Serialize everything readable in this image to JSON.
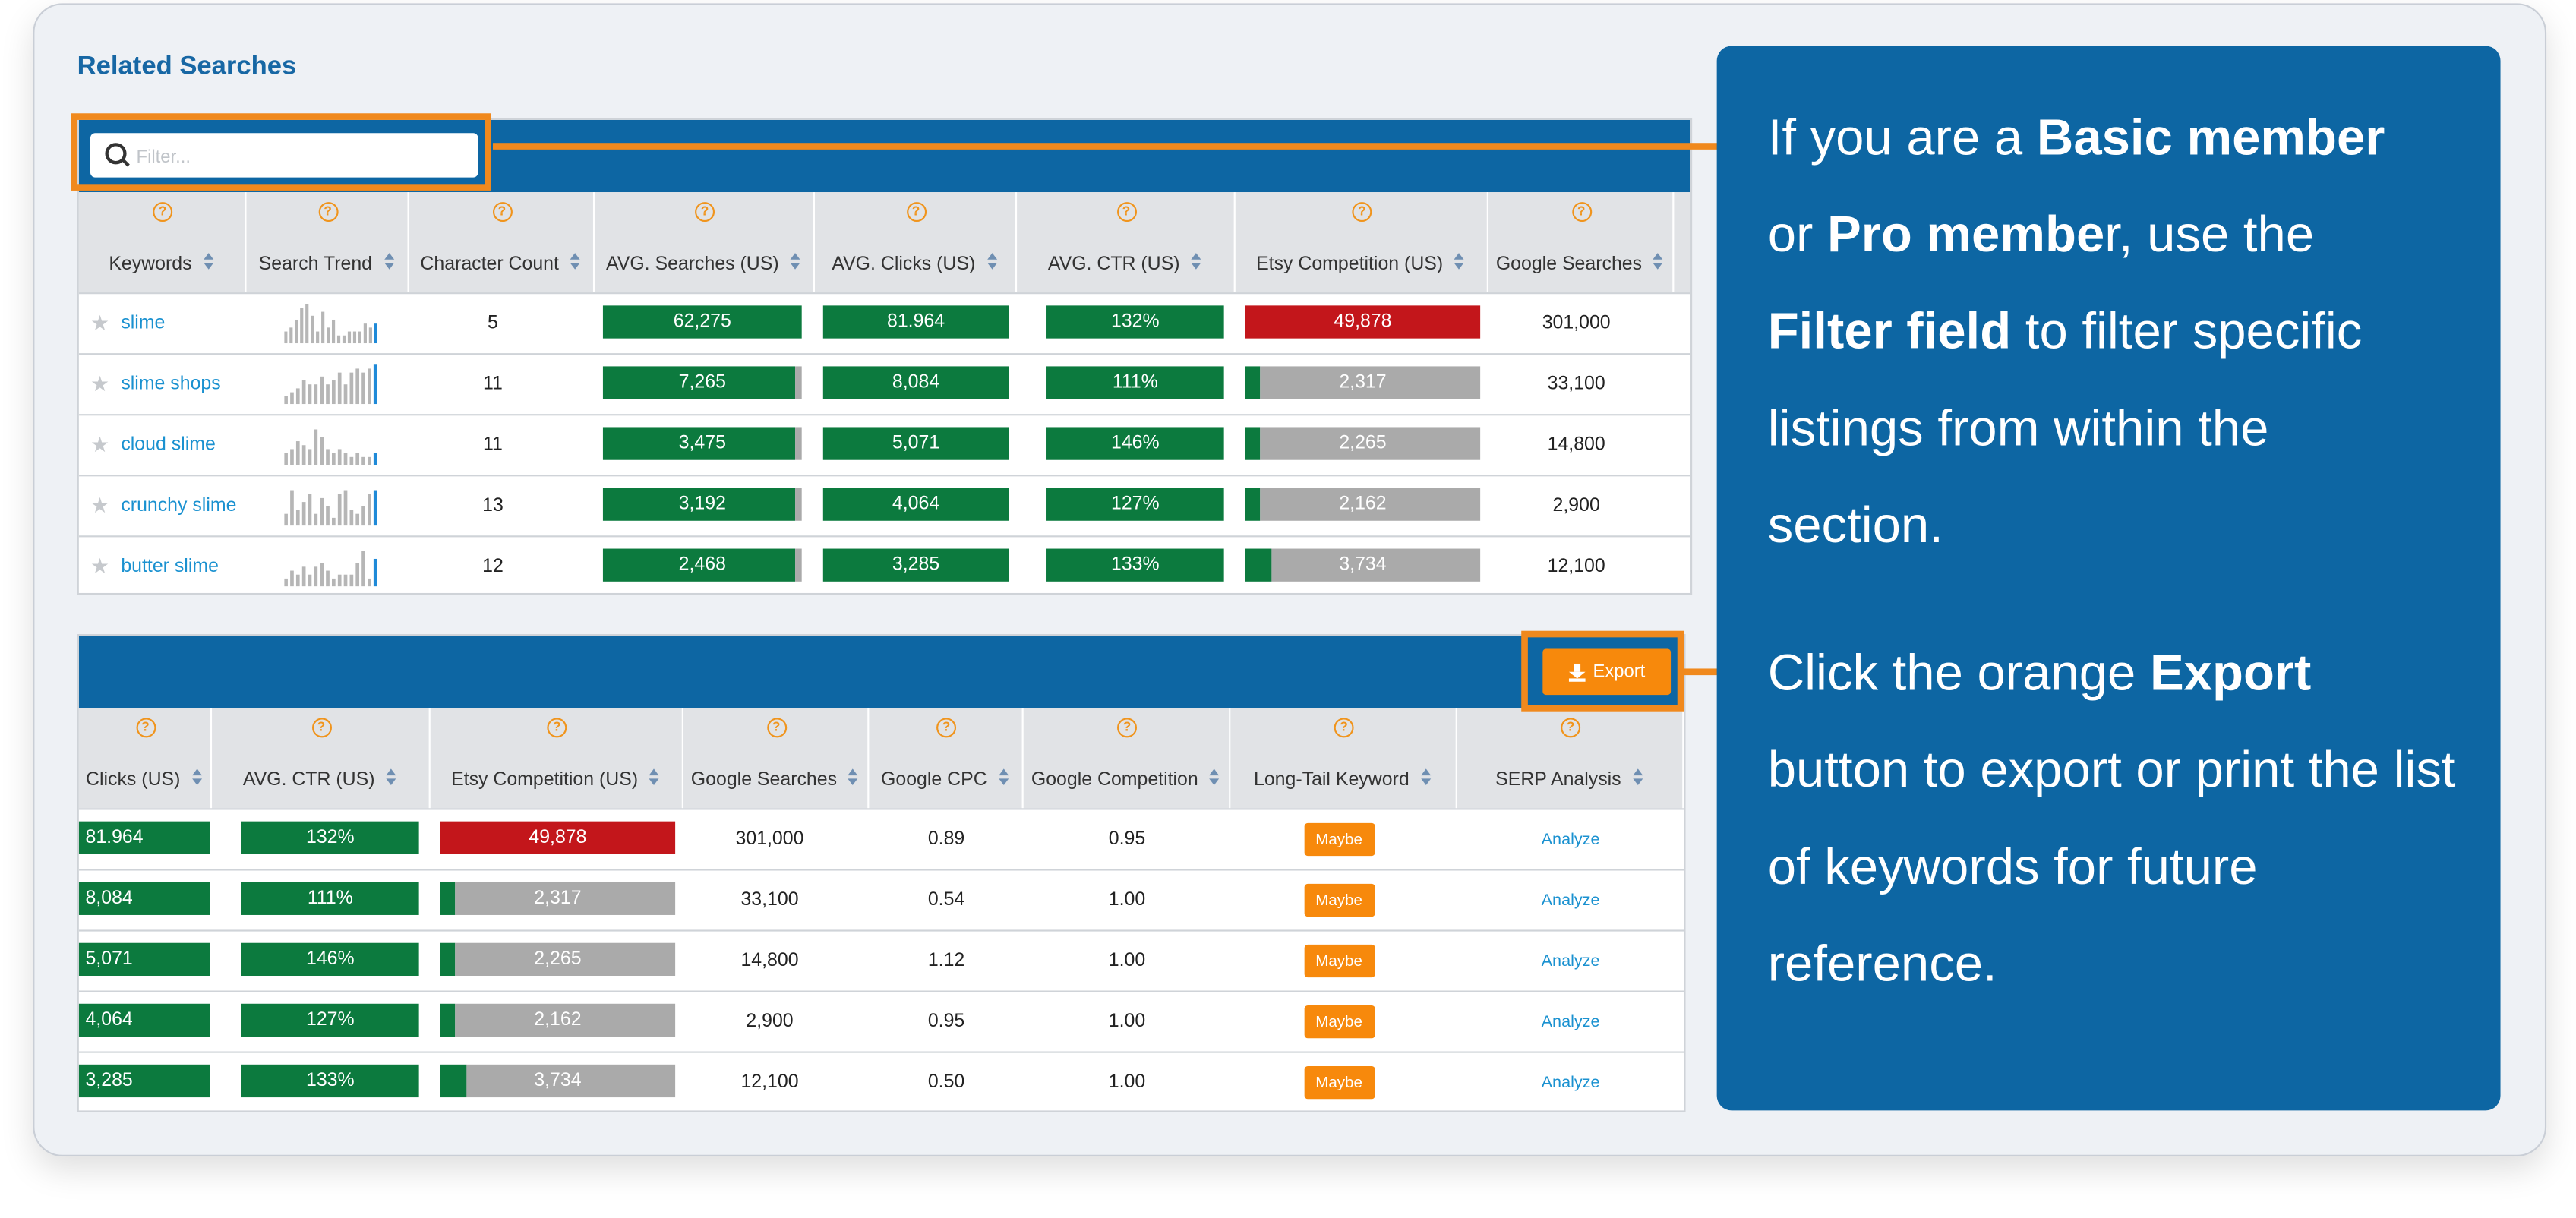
{
  "section_title": "Related Searches",
  "filter": {
    "placeholder": "Filter..."
  },
  "export_label": "Export",
  "top_table": {
    "headers": [
      "Keywords",
      "Search Trend",
      "Character Count",
      "AVG. Searches (US)",
      "AVG. Clicks (US)",
      "AVG. CTR (US)",
      "Etsy Competition (US)",
      "Google Searches"
    ],
    "rows": [
      {
        "keyword": "slime",
        "trend": [
          3,
          4,
          6,
          9,
          10,
          7,
          3,
          8,
          4,
          6,
          2,
          2,
          3,
          3,
          3,
          5,
          4,
          5
        ],
        "chars": "5",
        "searches": "62,275",
        "searches_fill": 1.0,
        "clicks": "81.964",
        "ctr": "132%",
        "etsy": "49,878",
        "etsy_fill": 1.0,
        "etsy_color": "#c3161b",
        "google": "301,000"
      },
      {
        "keyword": "slime shops",
        "trend": [
          2,
          3,
          4,
          6,
          5,
          5,
          7,
          5,
          6,
          8,
          5,
          8,
          9,
          8,
          9,
          10
        ],
        "chars": "11",
        "searches": "7,265",
        "searches_fill": 0.97,
        "clicks": "8,084",
        "ctr": "111%",
        "etsy": "2,317",
        "etsy_fill": 0.06,
        "etsy_color": "#0c7a3e",
        "google": "33,100"
      },
      {
        "keyword": "cloud slime",
        "trend": [
          3,
          4,
          6,
          5,
          4,
          9,
          7,
          4,
          3,
          4,
          3,
          2,
          3,
          2,
          2,
          3
        ],
        "chars": "11",
        "searches": "3,475",
        "searches_fill": 0.97,
        "clicks": "5,071",
        "ctr": "146%",
        "etsy": "2,265",
        "etsy_fill": 0.06,
        "etsy_color": "#0c7a3e",
        "google": "14,800"
      },
      {
        "keyword": "crunchy slime",
        "trend": [
          3,
          9,
          4,
          6,
          8,
          3,
          7,
          5,
          2,
          8,
          9,
          4,
          3,
          5,
          8,
          9
        ],
        "chars": "13",
        "searches": "3,192",
        "searches_fill": 0.97,
        "clicks": "4,064",
        "ctr": "127%",
        "etsy": "2,162",
        "etsy_fill": 0.06,
        "etsy_color": "#0c7a3e",
        "google": "2,900"
      },
      {
        "keyword": "butter slime",
        "trend": [
          2,
          4,
          3,
          5,
          3,
          5,
          6,
          4,
          2,
          3,
          3,
          3,
          6,
          9,
          2,
          7
        ],
        "chars": "12",
        "searches": "2,468",
        "searches_fill": 0.97,
        "clicks": "3,285",
        "ctr": "133%",
        "etsy": "3,734",
        "etsy_fill": 0.11,
        "etsy_color": "#0c7a3e",
        "google": "12,100"
      }
    ]
  },
  "bottom_table": {
    "headers": [
      "Clicks (US)",
      "AVG. CTR (US)",
      "Etsy Competition (US)",
      "Google Searches",
      "Google CPC",
      "Google Competition",
      "Long-Tail Keyword",
      "SERP Analysis"
    ],
    "rows": [
      {
        "clicks": "81.964",
        "ctr": "132%",
        "etsy": "49,878",
        "etsy_fill": 1.0,
        "etsy_color": "#c3161b",
        "google": "301,000",
        "cpc": "0.89",
        "comp": "0.95",
        "longtail": "Maybe",
        "serp": "Analyze"
      },
      {
        "clicks": "8,084",
        "ctr": "111%",
        "etsy": "2,317",
        "etsy_fill": 0.06,
        "etsy_color": "#0c7a3e",
        "google": "33,100",
        "cpc": "0.54",
        "comp": "1.00",
        "longtail": "Maybe",
        "serp": "Analyze"
      },
      {
        "clicks": "5,071",
        "ctr": "146%",
        "etsy": "2,265",
        "etsy_fill": 0.06,
        "etsy_color": "#0c7a3e",
        "google": "14,800",
        "cpc": "1.12",
        "comp": "1.00",
        "longtail": "Maybe",
        "serp": "Analyze"
      },
      {
        "clicks": "4,064",
        "ctr": "127%",
        "etsy": "2,162",
        "etsy_fill": 0.06,
        "etsy_color": "#0c7a3e",
        "google": "2,900",
        "cpc": "0.95",
        "comp": "1.00",
        "longtail": "Maybe",
        "serp": "Analyze"
      },
      {
        "clicks": "3,285",
        "ctr": "133%",
        "etsy": "3,734",
        "etsy_fill": 0.11,
        "etsy_color": "#0c7a3e",
        "google": "12,100",
        "cpc": "0.50",
        "comp": "1.00",
        "longtail": "Maybe",
        "serp": "Analyze"
      }
    ]
  },
  "callout": {
    "p1": {
      "t1": "If you are a ",
      "b1": "Basic member",
      "t2": " or ",
      "b2": "Pro membe",
      "t3": "r, use the ",
      "b3": "Filter field",
      "t4": " to filter specific listings from within the section."
    },
    "p2": {
      "t1": "Click the orange ",
      "b1": "Export",
      "t2": " button to export or print the list of keywords for future reference."
    }
  },
  "colors": {
    "brand_blue": "#0d66a3",
    "accent_orange": "#f0891d",
    "bar_green": "#0c7a3e",
    "bar_red": "#c3161b",
    "bar_gray": "#aaaaaa",
    "link_blue": "#1a91d0"
  }
}
